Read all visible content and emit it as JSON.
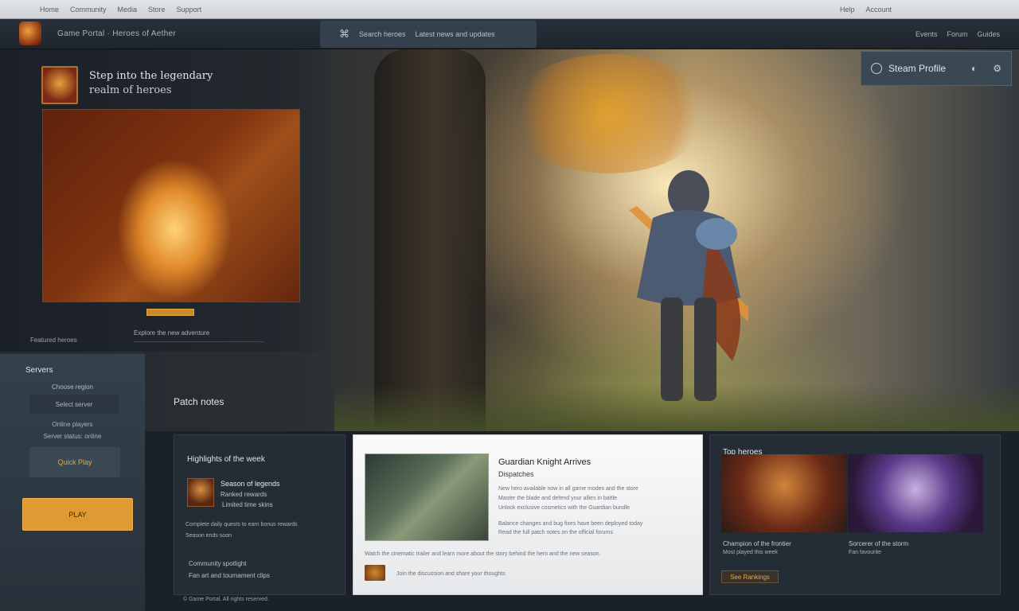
{
  "topbar": {
    "links": [
      "Home",
      "Community",
      "Media",
      "Store",
      "Support"
    ],
    "right_links": [
      "Help",
      "Account"
    ]
  },
  "header": {
    "logo_text": "Game Portal · Heroes of Aether",
    "search_placeholder": "Search heroes",
    "search_label": "Latest news and updates",
    "links": [
      "Events",
      "Forum",
      "Guides"
    ]
  },
  "hero": {
    "title": "Step into the legendary",
    "subtitle": "realm of heroes",
    "side_caption": "Featured heroes",
    "caption": "Explore the new adventure"
  },
  "user_badge": {
    "label": "Steam Profile"
  },
  "side_panel": {
    "title": "Servers",
    "subtitle": "Choose region",
    "field": "Select server",
    "line1": "Online players",
    "line2": "Server status: online",
    "select": "Quick Play"
  },
  "cta": {
    "label": "PLAY"
  },
  "section_label": "Patch notes",
  "card1": {
    "title": "Highlights of the week",
    "heading": "Season of legends",
    "h2": "Ranked rewards",
    "h3": "Limited time skins",
    "p1": "Complete daily quests to earn bonus rewards",
    "p2": "Season ends soon",
    "p3": "Community spotlight",
    "p4": "Fan art and tournament clips"
  },
  "footer_note": "© Game Portal. All rights reserved.",
  "card2": {
    "title": "Guardian Knight Arrives",
    "subtitle": "Dispatches",
    "lines": [
      "New hero available now in all game modes and the store",
      "Master the blade and defend your allies in battle",
      "Unlock exclusive cosmetics with the Guardian bundle",
      "Balance changes and bug fixes have been deployed today",
      "Read the full patch notes on the official forums"
    ],
    "full": "Watch the cinematic trailer and learn more about the story behind the hero and the new season.",
    "foot": "Join the discussion and share your thoughts"
  },
  "card3": {
    "title": "Top heroes",
    "cap1": "Champion of the frontier",
    "cap1b": "Most played this week",
    "cap2": "Sorcerer of the storm",
    "cap2b": "Fan favourite",
    "button": "See Rankings"
  },
  "colors": {
    "accent": "#e09a34",
    "panel": "#242d35",
    "header": "#28303a"
  }
}
